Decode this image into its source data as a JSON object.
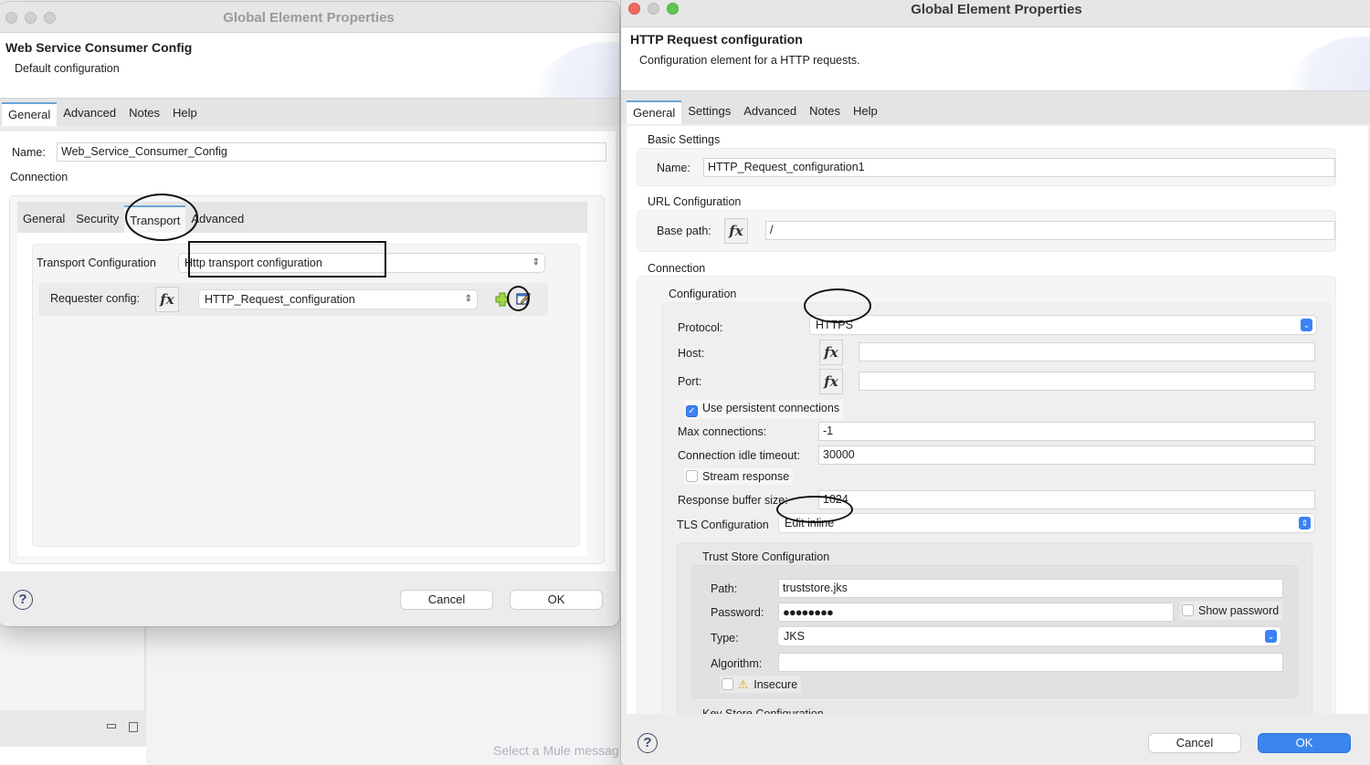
{
  "background": {
    "hint_text": "Select a Mule messag"
  },
  "left_dialog": {
    "window_title": "Global Element Properties",
    "header_title": "Web Service Consumer Config",
    "header_subtitle": "Default configuration",
    "tabs": [
      {
        "label": "General",
        "active": true
      },
      {
        "label": "Advanced",
        "active": false
      },
      {
        "label": "Notes",
        "active": false
      },
      {
        "label": "Help",
        "active": false
      }
    ],
    "name_label": "Name:",
    "name_value": "Web_Service_Consumer_Config",
    "connection_label": "Connection",
    "connection_tabs": [
      {
        "label": "General",
        "active": false
      },
      {
        "label": "Security",
        "active": false
      },
      {
        "label": "Transport",
        "active": true
      },
      {
        "label": "Advanced",
        "active": false
      }
    ],
    "transport_config_label": "Transport Configuration",
    "transport_config_value": "Http transport configuration",
    "requester_config_label": "Requester config:",
    "requester_config_value": "HTTP_Request_configuration",
    "fx_label": "fx",
    "help_glyph": "?",
    "cancel_label": "Cancel",
    "ok_label": "OK"
  },
  "right_dialog": {
    "window_title": "Global Element Properties",
    "header_title": "HTTP Request configuration",
    "header_subtitle": "Configuration element for a HTTP requests.",
    "tabs": [
      {
        "label": "General",
        "active": true
      },
      {
        "label": "Settings",
        "active": false
      },
      {
        "label": "Advanced",
        "active": false
      },
      {
        "label": "Notes",
        "active": false
      },
      {
        "label": "Help",
        "active": false
      }
    ],
    "basic_settings": {
      "title": "Basic Settings",
      "name_label": "Name:",
      "name_value": "HTTP_Request_configuration1"
    },
    "url_configuration": {
      "title": "URL Configuration",
      "base_path_label": "Base path:",
      "base_path_value": "/"
    },
    "connection": {
      "title": "Connection",
      "configuration_title": "Configuration",
      "protocol_label": "Protocol:",
      "protocol_value": "HTTPS",
      "host_label": "Host:",
      "host_value": "",
      "port_label": "Port:",
      "port_value": "",
      "persistent_label": "Use persistent connections",
      "persistent_checked": true,
      "max_connections_label": "Max connections:",
      "max_connections_value": "-1",
      "idle_timeout_label": "Connection idle timeout:",
      "idle_timeout_value": "30000",
      "stream_response_label": "Stream response",
      "stream_response_checked": false,
      "buffer_size_label": "Response buffer size:",
      "buffer_size_value": "1024",
      "tls_label": "TLS Configuration",
      "tls_value": "Edit inline"
    },
    "trust_store": {
      "title": "Trust Store Configuration",
      "path_label": "Path:",
      "path_value": "truststore.jks",
      "password_label": "Password:",
      "password_value": "●●●●●●●●",
      "show_password_label": "Show password",
      "show_password_checked": false,
      "type_label": "Type:",
      "type_value": "JKS",
      "algorithm_label": "Algorithm:",
      "algorithm_value": "",
      "insecure_label": "Insecure",
      "insecure_checked": false
    },
    "key_store_title": "Key Store Configuration",
    "fx_label": "fx",
    "help_glyph": "?",
    "cancel_label": "Cancel",
    "ok_label": "OK"
  },
  "colors": {
    "primary_button": "#3a86ee",
    "active_tab_indicator": "#6aa6d8",
    "select_chevron": "#3b82f6"
  }
}
